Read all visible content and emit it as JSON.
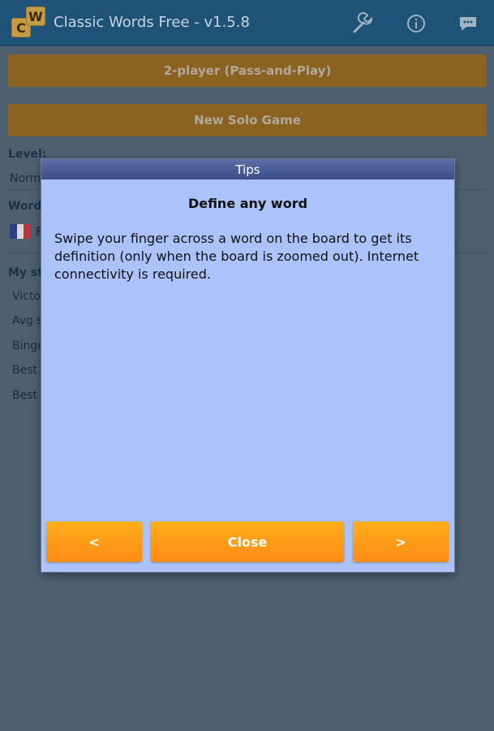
{
  "app": {
    "title": "Classic Words Free - v1.5.8",
    "logo_letters": [
      "C",
      "W"
    ],
    "actions": [
      {
        "name": "settings-icon",
        "icon": "wrench"
      },
      {
        "name": "info-icon",
        "icon": "info"
      },
      {
        "name": "feedback-icon",
        "icon": "chat-bubble"
      }
    ]
  },
  "menu": {
    "two_player_label": "2-player (Pass-and-Play)",
    "new_solo_label": "New Solo Game"
  },
  "level": {
    "label": "Level:",
    "value_partial": "Norm"
  },
  "word": {
    "label_partial": "Word",
    "value_partial": "F"
  },
  "stats": {
    "label_partial": "My st",
    "items_partial": [
      "Victo",
      "Avg s",
      "Bingo",
      "Best w",
      "Best t"
    ]
  },
  "dialog": {
    "header": "Tips",
    "title": "Define any word",
    "body": "Swipe your finger across a word on the board to get its definition (only when the board is zoomed out). Internet connectivity is required.",
    "prev_label": "<",
    "close_label": "Close",
    "next_label": ">"
  },
  "colors": {
    "accent_orange": "#ff9a16",
    "dialog_bg": "#abc3fa",
    "app_bar": "#1e5277"
  }
}
